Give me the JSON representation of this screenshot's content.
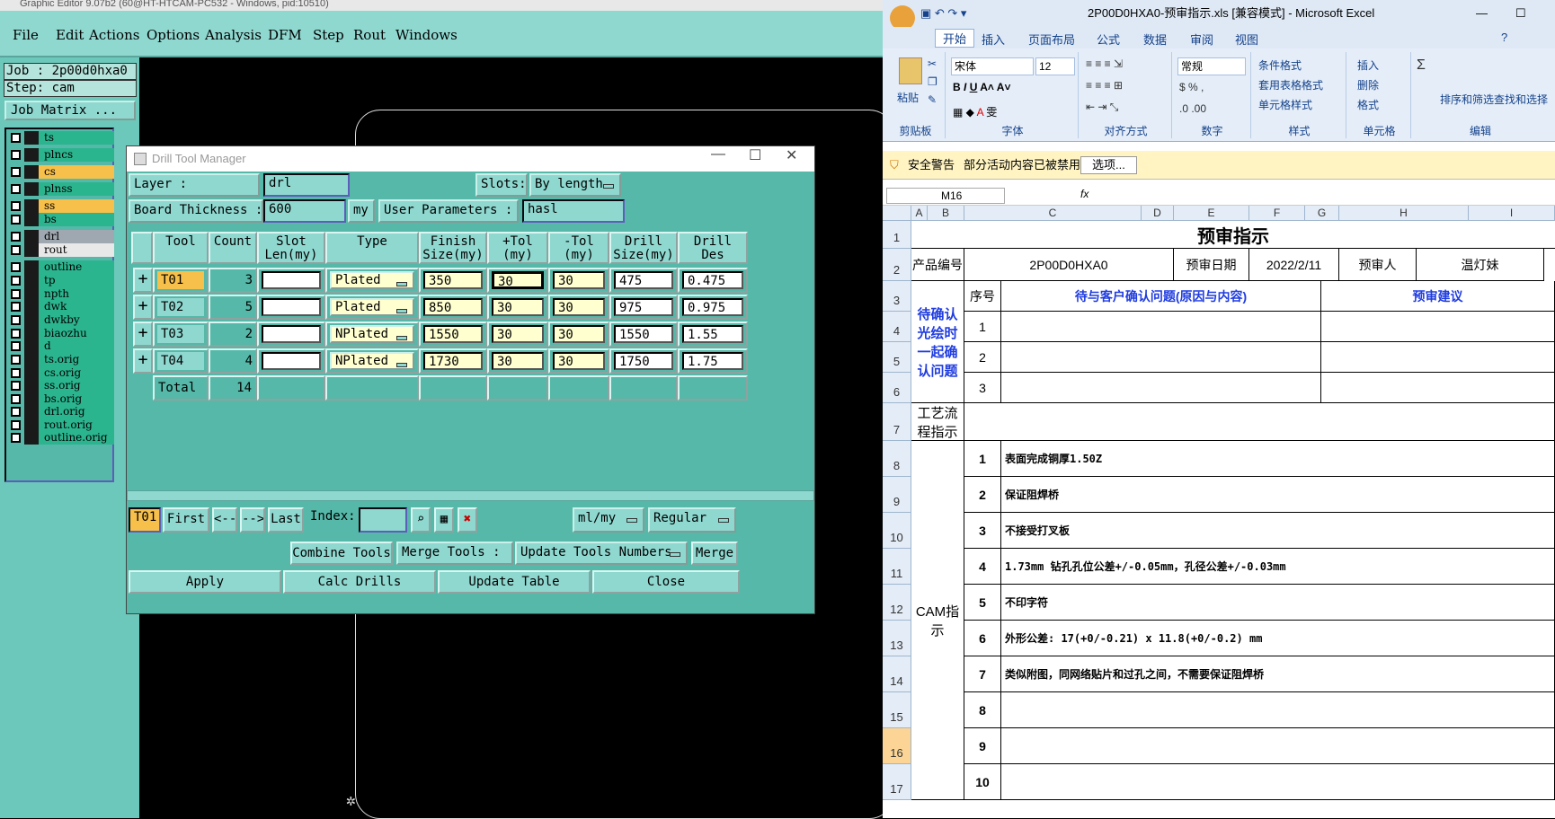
{
  "genesis": {
    "title": "Graphic Editor 9.07b2 (60@HT-HTCAM-PC532 - Windows, pid:10510)",
    "menu": [
      "File",
      "Edit",
      "Actions",
      "Options",
      "Analysis",
      "DFM",
      "Step",
      "Rout",
      "Windows"
    ],
    "job_label": "Job : 2p00d0hxa0",
    "step_label": "Step: cam",
    "job_matrix": "Job Matrix ...",
    "layers": [
      {
        "name": "ts",
        "color": "#2bb58f"
      },
      {
        "name": "plncs",
        "color": "#2bb58f"
      },
      {
        "name": "cs",
        "color": "#f7c04a"
      },
      {
        "name": "plnss",
        "color": "#2bb58f"
      },
      {
        "name": "ss",
        "color": "#f7c04a"
      },
      {
        "name": "bs",
        "color": "#2bb58f"
      },
      {
        "name": "drl",
        "color": "#9fa8b0"
      },
      {
        "name": "rout",
        "color": "#e8e8e8"
      },
      {
        "name": "outline",
        "color": "#2bb58f"
      },
      {
        "name": "tp",
        "color": "#2bb58f"
      },
      {
        "name": "npth",
        "color": "#2bb58f"
      },
      {
        "name": "dwk",
        "color": "#2bb58f"
      },
      {
        "name": "dwkby",
        "color": "#2bb58f"
      },
      {
        "name": "biaozhu",
        "color": "#2bb58f"
      },
      {
        "name": "d",
        "color": "#2bb58f"
      },
      {
        "name": "ts.orig",
        "color": "#2bb58f"
      },
      {
        "name": "cs.orig",
        "color": "#2bb58f"
      },
      {
        "name": "ss.orig",
        "color": "#2bb58f"
      },
      {
        "name": "bs.orig",
        "color": "#2bb58f"
      },
      {
        "name": "drl.orig",
        "color": "#2bb58f"
      },
      {
        "name": "rout.orig",
        "color": "#2bb58f"
      },
      {
        "name": "outline.orig",
        "color": "#2bb58f"
      }
    ]
  },
  "dtm": {
    "title": "Drill Tool Manager",
    "layer_label": "Layer          :",
    "layer_value": "drl",
    "slots_label": "Slots:",
    "slots_value": "By length",
    "thickness_label": "Board Thickness :",
    "thickness_value": "600",
    "thickness_unit": "my",
    "user_params_label": "User Parameters :",
    "user_params_value": "hasl",
    "columns": [
      "Tool",
      "Count",
      "Slot\nLen(my)",
      "Type",
      "Finish\nSize(my)",
      "+Tol\n(my)",
      "-Tol\n(my)",
      "Drill\nSize(my)",
      "Drill\nDes"
    ],
    "rows": [
      {
        "tool": "T01",
        "count": "3",
        "slot": "",
        "type": "Plated",
        "finish": "350",
        "ptol": "30",
        "mtol": "30",
        "drill": "475",
        "des": "0.475"
      },
      {
        "tool": "T02",
        "count": "5",
        "slot": "",
        "type": "Plated",
        "finish": "850",
        "ptol": "30",
        "mtol": "30",
        "drill": "975",
        "des": "0.975"
      },
      {
        "tool": "T03",
        "count": "2",
        "slot": "",
        "type": "NPlated",
        "finish": "1550",
        "ptol": "30",
        "mtol": "30",
        "drill": "1550",
        "des": "1.55"
      },
      {
        "tool": "T04",
        "count": "4",
        "slot": "",
        "type": "NPlated",
        "finish": "1730",
        "ptol": "30",
        "mtol": "30",
        "drill": "1750",
        "des": "1.75"
      }
    ],
    "total_label": "Total",
    "total_count": "14",
    "nav": {
      "current": "T01",
      "first": "First",
      "prev": "<--",
      "next": "-->",
      "last": "Last",
      "index_label": "Index:",
      "units": "ml/my",
      "mode": "Regular"
    },
    "combine": "Combine Tools",
    "merge_label": "Merge Tools :",
    "merge_option": "Update Tools Numbers",
    "merge_btn": "Merge",
    "apply": "Apply",
    "calc": "Calc Drills",
    "update": "Update Table",
    "close": "Close"
  },
  "excel": {
    "title": "2P00D0HXA0-预审指示.xls  [兼容模式] - Microsoft Excel",
    "tabs": [
      "开始",
      "插入",
      "页面布局",
      "公式",
      "数据",
      "审阅",
      "视图"
    ],
    "font_name": "宋体",
    "font_size": "12",
    "number_format": "常规",
    "groups": [
      "剪贴板",
      "字体",
      "对齐方式",
      "数字",
      "样式",
      "单元格",
      "编辑"
    ],
    "paste": "粘贴",
    "style_items": [
      "条件格式",
      "套用表格格式",
      "单元格样式"
    ],
    "cell_items": [
      "插入",
      "删除",
      "格式"
    ],
    "edit_items": [
      "排序和筛选",
      "查找和选择"
    ],
    "security_label": "安全警告",
    "security_text": "部分活动内容已被禁用。",
    "security_btn": "选项...",
    "name_box": "M16",
    "fx": "fx",
    "col_headers": [
      "A",
      "B",
      "C",
      "D",
      "E",
      "F",
      "G",
      "H",
      "I"
    ],
    "row_headers": [
      "1",
      "2",
      "3",
      "4",
      "5",
      "6",
      "7",
      "8",
      "9",
      "10",
      "11",
      "12",
      "13",
      "14",
      "15",
      "16",
      "17"
    ],
    "sheet_title": "预审指示",
    "product_label": "产品编号",
    "product_value": "2P00D0HXA0",
    "date_label": "预审日期",
    "date_value": "2022/2/11",
    "reviewer_label": "预审人",
    "reviewer_value": "温灯妹",
    "seq_label": "序号",
    "issue_header": "待与客户确认问题(原因与内容)",
    "suggest_header": "预审建议",
    "confirm_label": "待确认光绘时一起确认问题",
    "process_label": "工艺流程指示",
    "cam_label": "CAM指示",
    "cam_items": [
      {
        "no": "1",
        "text": "表面完成铜厚1.50Z"
      },
      {
        "no": "2",
        "text": "保证阻焊桥"
      },
      {
        "no": "3",
        "text": "不接受打叉板"
      },
      {
        "no": "4",
        "text": "1.73mm 钻孔孔位公差+/-0.05mm，孔径公差+/-0.03mm"
      },
      {
        "no": "5",
        "text": "不印字符"
      },
      {
        "no": "6",
        "text": "外形公差:  17(+0/-0.21) x 11.8(+0/-0.2) mm"
      },
      {
        "no": "7",
        "text": "类似附图，同网络贴片和过孔之间，不需要保证阻焊桥"
      },
      {
        "no": "8",
        "text": ""
      },
      {
        "no": "9",
        "text": ""
      },
      {
        "no": "10",
        "text": ""
      }
    ]
  }
}
